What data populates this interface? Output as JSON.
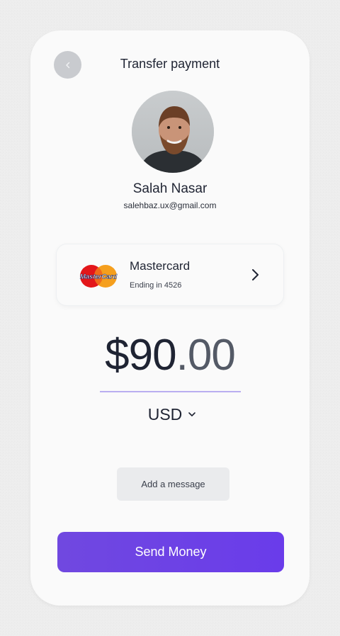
{
  "header": {
    "title": "Transfer payment",
    "back_icon": "chevron-left-icon"
  },
  "recipient": {
    "name": "Salah Nasar",
    "email": "salehbaz.ux@gmail.com"
  },
  "payment_method": {
    "brand": "Mastercard",
    "logo_text": "MasterCard",
    "ending": "Ending in 4526"
  },
  "amount": {
    "main": "$90",
    "cents": ".00",
    "currency": "USD"
  },
  "actions": {
    "message_label": "Add a message",
    "send_label": "Send Money"
  },
  "colors": {
    "accent": "#6a3cea",
    "underline": "#b9aef0"
  }
}
